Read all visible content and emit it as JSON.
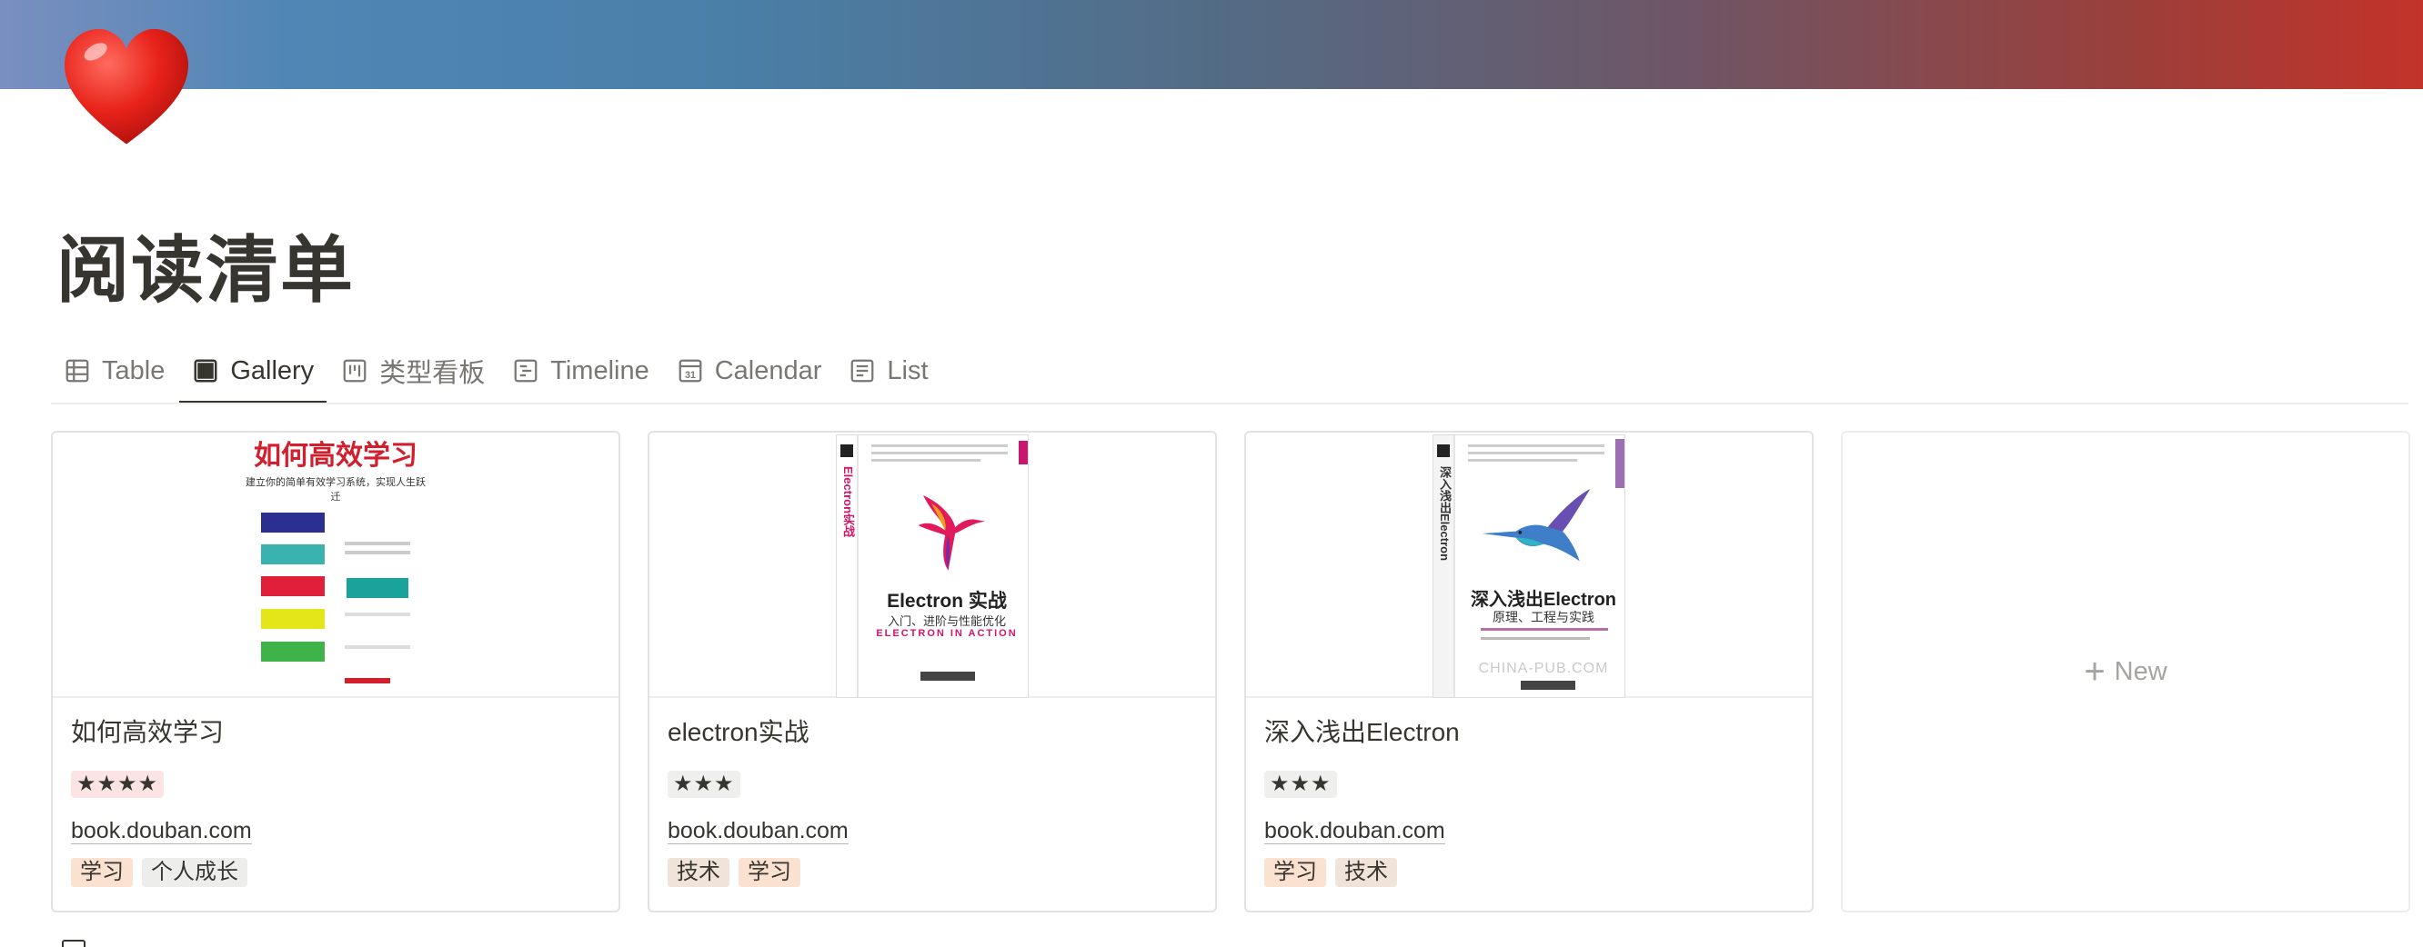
{
  "page": {
    "title": "阅读清单",
    "icon": "red-heart-icon"
  },
  "colors": {
    "cover_gradient": [
      "#7a8fc0",
      "#4a7fa8",
      "#6f5565",
      "#c2332a"
    ],
    "active_tab_underline": "#37352f",
    "text": "#37352f",
    "muted": "#787774"
  },
  "tabs": [
    {
      "label": "Table",
      "icon": "table-icon"
    },
    {
      "label": "Gallery",
      "icon": "gallery-icon",
      "active": true
    },
    {
      "label": "类型看板",
      "icon": "board-icon"
    },
    {
      "label": "Timeline",
      "icon": "timeline-icon"
    },
    {
      "label": "Calendar",
      "icon": "calendar-icon",
      "icon_text": "31"
    },
    {
      "label": "List",
      "icon": "list-icon"
    }
  ],
  "cards": [
    {
      "title": "如何高效学习",
      "rating": "★★★★",
      "url": "book.douban.com",
      "tags": [
        "学习",
        "个人成长"
      ],
      "cover": {
        "title": "如何高效学习",
        "subtitle": "建立你的简单有效学习系统，实现人生跃迁"
      }
    },
    {
      "title": "electron实战",
      "rating": "★★★",
      "url": "book.douban.com",
      "tags": [
        "技术",
        "学习"
      ],
      "cover": {
        "spine": "Electron实战",
        "title": "Electron 实战",
        "subtitle": "入门、进阶与性能优化",
        "english": "ELECTRON IN ACTION"
      }
    },
    {
      "title": "深入浅出Electron",
      "rating": "★★★",
      "url": "book.douban.com",
      "tags": [
        "学习",
        "技术"
      ],
      "cover": {
        "spine": "深入浅出Electron",
        "title": "深入浅出Electron",
        "subtitle": "原理、工程与实践",
        "watermark": "CHINA-PUB.COM"
      }
    }
  ],
  "new_card": {
    "label": "New"
  }
}
